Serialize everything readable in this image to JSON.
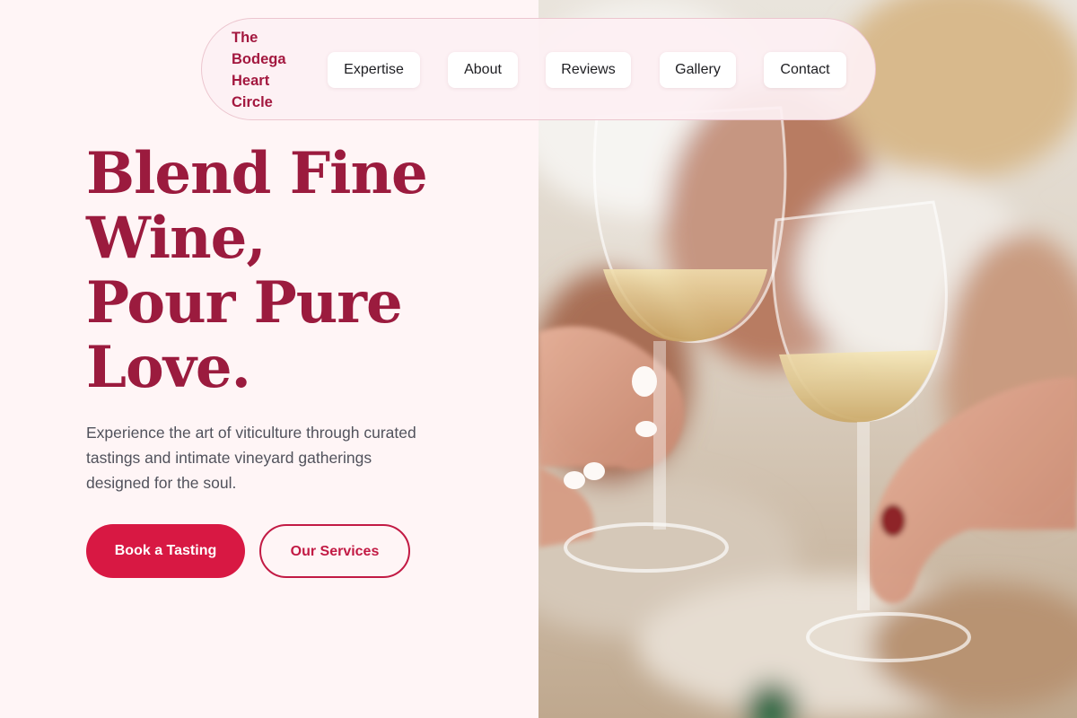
{
  "nav": {
    "brand": "The Bodega Heart Circle",
    "brand_lines": [
      "The",
      "Bodega",
      "Heart",
      "Circle"
    ],
    "links": [
      {
        "label": "Expertise"
      },
      {
        "label": "About"
      },
      {
        "label": "Reviews"
      },
      {
        "label": "Gallery"
      },
      {
        "label": "Contact"
      }
    ]
  },
  "hero": {
    "title_lines": [
      "Blend Fine",
      "Wine,",
      "Pour Pure",
      "Love."
    ],
    "subtitle": "Experience the art of viticulture through curated tastings and intimate vineyard gatherings designed for the soul.",
    "primary_cta": "Book a Tasting",
    "secondary_cta": "Our Services"
  },
  "colors": {
    "page_background": "#fff5f6",
    "title": "#9b1b3e",
    "brand": "#a3183f",
    "primary_button": "#d81843",
    "outline_button": "#c21a44",
    "body_text": "#51525c"
  },
  "photo": {
    "description_icon": "wine-toast-photo"
  }
}
